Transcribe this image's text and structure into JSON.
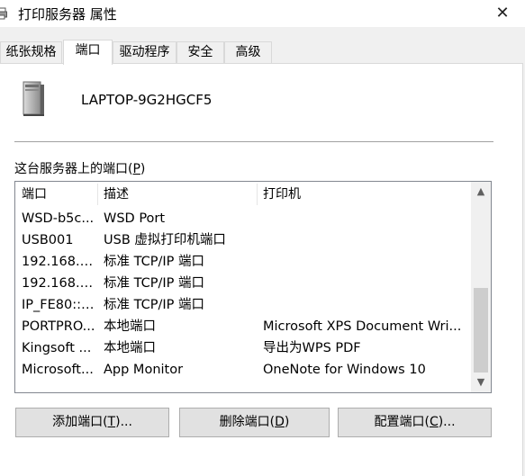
{
  "window": {
    "title": "打印服务器 属性",
    "close_label": "✕"
  },
  "tabs": [
    {
      "label": "纸张规格",
      "active": false
    },
    {
      "label": "端口",
      "active": true
    },
    {
      "label": "驱动程序",
      "active": false
    },
    {
      "label": "安全",
      "active": false
    },
    {
      "label": "高级",
      "active": false
    }
  ],
  "server": {
    "name": "LAPTOP-9G2HGCF5",
    "icon": "server-computer-icon"
  },
  "ports_section": {
    "label": "这台服务器上的端口(",
    "accel": "P",
    "label_end": ")"
  },
  "list": {
    "columns": [
      "端口",
      "描述",
      "打印机"
    ],
    "rows": [
      {
        "port": "WSD-b5c...",
        "desc": "WSD Port",
        "printer": ""
      },
      {
        "port": "USB001",
        "desc": "USB 虚拟打印机端口",
        "printer": ""
      },
      {
        "port": "192.168.1...",
        "desc": "标准 TCP/IP 端口",
        "printer": ""
      },
      {
        "port": "192.168.1...",
        "desc": "标准 TCP/IP 端口",
        "printer": ""
      },
      {
        "port": "IP_FE80::8...",
        "desc": "标准 TCP/IP 端口",
        "printer": ""
      },
      {
        "port": "PORTPRO...",
        "desc": "本地端口",
        "printer": "Microsoft XPS Document Wri..."
      },
      {
        "port": "Kingsoft ...",
        "desc": "本地端口",
        "printer": "导出为WPS PDF"
      },
      {
        "port": "Microsoft...",
        "desc": "App Monitor",
        "printer": "OneNote for Windows 10"
      }
    ],
    "scroll_up": "▲",
    "scroll_down": "▼"
  },
  "buttons": {
    "add": {
      "pre": "添加端口(",
      "accel": "T",
      "post": ")..."
    },
    "delete": {
      "pre": "删除端口(",
      "accel": "D",
      "post": ")"
    },
    "configure": {
      "pre": "配置端口(",
      "accel": "C",
      "post": ")..."
    }
  },
  "colors": {
    "panel": "#ffffff",
    "chrome": "#f0f0f0",
    "button": "#e1e1e1",
    "border": "#adadad",
    "scroll_thumb": "#cdcdcd"
  }
}
